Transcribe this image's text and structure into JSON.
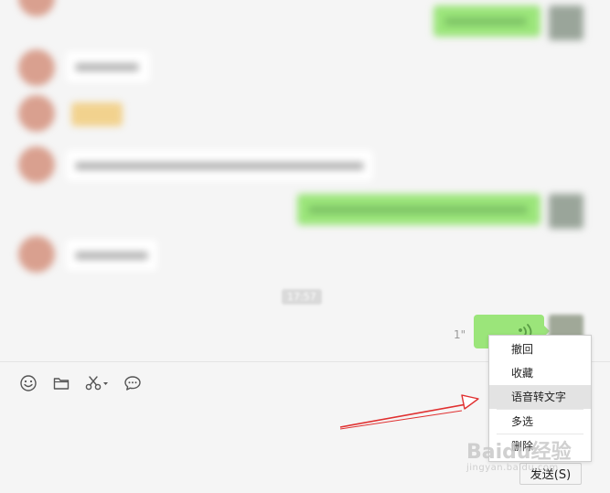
{
  "timestamp": "17:57",
  "voice_message": {
    "duration": "1\""
  },
  "toolbar": {
    "icons": [
      "emoji-icon",
      "folder-icon",
      "scissors-icon",
      "chat-history-icon"
    ]
  },
  "send_button": {
    "label": "发送(S)"
  },
  "context_menu": {
    "items": [
      "撤回",
      "收藏",
      "语音转文字",
      "多选",
      "删除"
    ],
    "highlighted": "语音转文字"
  },
  "watermark": {
    "main": "Baidu经验",
    "sub": "jingyan.baidu.com"
  },
  "colors": {
    "background": "#f5f5f5",
    "my_bubble": "#9be57a",
    "their_bubble": "#ffffff",
    "menu_highlight": "#e3e3e3",
    "arrow": "#e03030"
  }
}
